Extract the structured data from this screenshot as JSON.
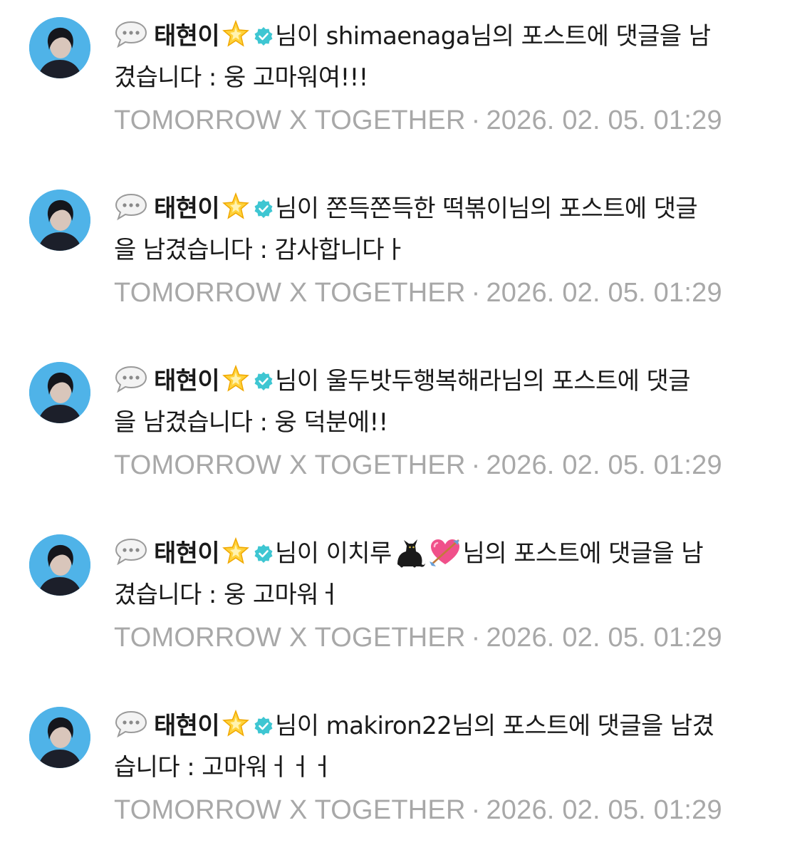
{
  "notifications": [
    {
      "name": "태현이",
      "line1": "님이 shimaenaga님의 포스트에 댓글을 남",
      "line2": "겼습니다 : 웅 고마워여!!!",
      "community": "TOMORROW X TOGETHER",
      "separator": "·",
      "timestamp": "2026. 02. 05. 01:29"
    },
    {
      "name": "태현이",
      "line1": "님이 쫀득쫀득한 떡볶이님의 포스트에 댓글",
      "line2": "을 남겼습니다 : 감사합니다ㅏ",
      "community": "TOMORROW X TOGETHER",
      "separator": "·",
      "timestamp": "2026. 02. 05. 01:29"
    },
    {
      "name": "태현이",
      "line1": "님이 울두밧두행복해라님의 포스트에 댓글",
      "line2": "을 남겼습니다 : 웅 덕분에!!",
      "community": "TOMORROW X TOGETHER",
      "separator": "·",
      "timestamp": "2026. 02. 05. 01:29"
    },
    {
      "name": "태현이",
      "line1a": "님이 이치루",
      "line1b": "님의 포스트에 댓글을 남",
      "line2": "겼습니다 : 웅 고마워ㅓ",
      "community": "TOMORROW X TOGETHER",
      "separator": "·",
      "timestamp": "2026. 02. 05. 01:29"
    },
    {
      "name": "태현이",
      "line1": "님이 makiron22님의 포스트에 댓글을 남겼",
      "line2": "습니다 : 고마워ㅓㅓㅓ",
      "community": "TOMORROW X TOGETHER",
      "separator": "·",
      "timestamp": "2026. 02. 05. 01:29"
    }
  ],
  "icons": {
    "comment": "speech-bubble-icon",
    "badge": "glowing-star-icon",
    "verified": "verified-badge-icon",
    "emoji_cat": "black-cat-emoji",
    "emoji_heart": "heart-with-arrow-emoji"
  },
  "colors": {
    "meta_text": "#a8a8a8",
    "verified": "#3ec6d2",
    "avatar_bg": "#4fb3e8"
  }
}
